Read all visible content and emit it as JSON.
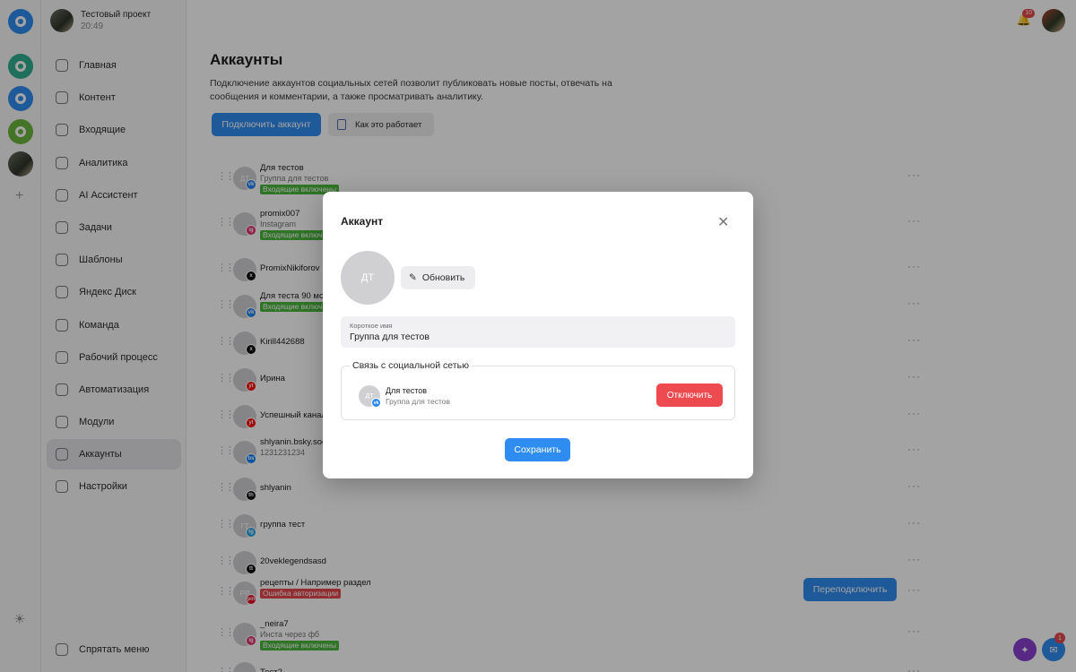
{
  "project": {
    "name": "Тестовый проект",
    "time": "20:49"
  },
  "rail": {
    "logos": [
      {
        "name": "rail-logo-1",
        "color": "#2f8cf0"
      },
      {
        "name": "rail-logo-2",
        "color": "#2fae8f"
      },
      {
        "name": "rail-logo-3",
        "color": "#2f8cf0"
      },
      {
        "name": "rail-logo-4",
        "color": "#6bb63a"
      }
    ],
    "add_label": "+"
  },
  "sidebar": {
    "items": [
      {
        "label": "Главная",
        "icon": "home-icon"
      },
      {
        "label": "Контент",
        "icon": "calendar-icon"
      },
      {
        "label": "Входящие",
        "icon": "chat-icon"
      },
      {
        "label": "Аналитика",
        "icon": "chart-icon"
      },
      {
        "label": "AI Ассистент",
        "icon": "sparkle-icon"
      },
      {
        "label": "Задачи",
        "icon": "board-icon"
      },
      {
        "label": "Шаблоны",
        "icon": "template-icon"
      },
      {
        "label": "Яндекс Диск",
        "icon": "disk-icon"
      },
      {
        "label": "Команда",
        "icon": "team-icon"
      },
      {
        "label": "Рабочий процесс",
        "icon": "workflow-icon"
      },
      {
        "label": "Автоматизация",
        "icon": "bolt-icon"
      },
      {
        "label": "Модули",
        "icon": "modules-icon"
      },
      {
        "label": "Аккаунты",
        "icon": "accounts-icon",
        "active": true
      },
      {
        "label": "Настройки",
        "icon": "gear-icon"
      }
    ],
    "hide_menu": "Спрятать меню"
  },
  "header": {
    "bell_count": "10",
    "fab_badge": "1"
  },
  "main": {
    "title": "Аккаунты",
    "description": "Подключение аккаунтов социальных сетей позволит публиковать новые посты, отвечать на сообщения и комментарии, а также просматривать аналитику.",
    "connect_button": "Подключить аккаунт",
    "how_button": "Как это работает",
    "reconnect_button": "Переподключить",
    "dots": "···",
    "accounts": [
      {
        "initials": "ДТ",
        "name": "Для тестов",
        "sub": "Группа для тестов",
        "badge": "Входящие включены",
        "badge_type": "green",
        "net": "vk",
        "net_color": "#2787f5"
      },
      {
        "initials": "",
        "name": "promix007",
        "sub": "Instagram",
        "badge": "Входящие включены",
        "badge_type": "green",
        "net": "ig",
        "net_color": "#e1306c"
      },
      {
        "initials": "",
        "name": "PromixNikiforov",
        "sub": "",
        "badge": "",
        "badge_type": "",
        "net": "x",
        "net_color": "#111111"
      },
      {
        "initials": "",
        "name": "Для теста 90 мс",
        "sub": "",
        "badge": "Входящие включены",
        "badge_type": "green",
        "net": "vk",
        "net_color": "#2787f5"
      },
      {
        "initials": "",
        "name": "Kirill442688",
        "sub": "",
        "badge": "",
        "badge_type": "",
        "net": "x",
        "net_color": "#111111"
      },
      {
        "initials": "",
        "name": "Ирина",
        "sub": "",
        "badge": "",
        "badge_type": "",
        "net": "yt",
        "net_color": "#ff0000"
      },
      {
        "initials": "",
        "name": "Успешный канал",
        "sub": "",
        "badge": "",
        "badge_type": "",
        "net": "yt",
        "net_color": "#ff0000"
      },
      {
        "initials": "",
        "name": "shlyanin.bsky.social",
        "sub": "1231231234",
        "badge": "",
        "badge_type": "",
        "net": "bs",
        "net_color": "#1185fe"
      },
      {
        "initials": "",
        "name": "shlyanin",
        "sub": "",
        "badge": "",
        "badge_type": "",
        "net": "th",
        "net_color": "#111111"
      },
      {
        "initials": "ГТ",
        "name": "группа тест",
        "sub": "",
        "badge": "",
        "badge_type": "",
        "net": "tg",
        "net_color": "#27a7e7"
      },
      {
        "initials": "",
        "name": "20veklegendsasd",
        "sub": "",
        "badge": "",
        "badge_type": "",
        "net": "tt",
        "net_color": "#111111"
      },
      {
        "initials": "РР",
        "name": "рецепты / Например раздел",
        "sub": "",
        "badge": "Ошибка авторизации",
        "badge_type": "red",
        "net": "pin",
        "net_color": "#e60023",
        "reconnect": true
      },
      {
        "initials": "",
        "name": "_neira7",
        "sub": "Инста через фб",
        "badge": "Входящие включены",
        "badge_type": "green",
        "net": "ig",
        "net_color": "#e1306c"
      },
      {
        "initials": "",
        "name": "Тест2",
        "sub": "",
        "badge": "",
        "badge_type": "",
        "net": "vk",
        "net_color": "#2787f5"
      }
    ]
  },
  "modal": {
    "title": "Аккаунт",
    "avatar_initials": "ДТ",
    "refresh_button": "Обновить",
    "short_name_label": "Короткое имя",
    "short_name_value": "Группа для тестов",
    "social_legend": "Связь с социальной сетью",
    "social_initials": "ДТ",
    "social_net": "vk",
    "social_name": "Для тестов",
    "social_sub": "Группа для тестов",
    "disconnect_button": "Отключить",
    "save_button": "Сохранить"
  }
}
